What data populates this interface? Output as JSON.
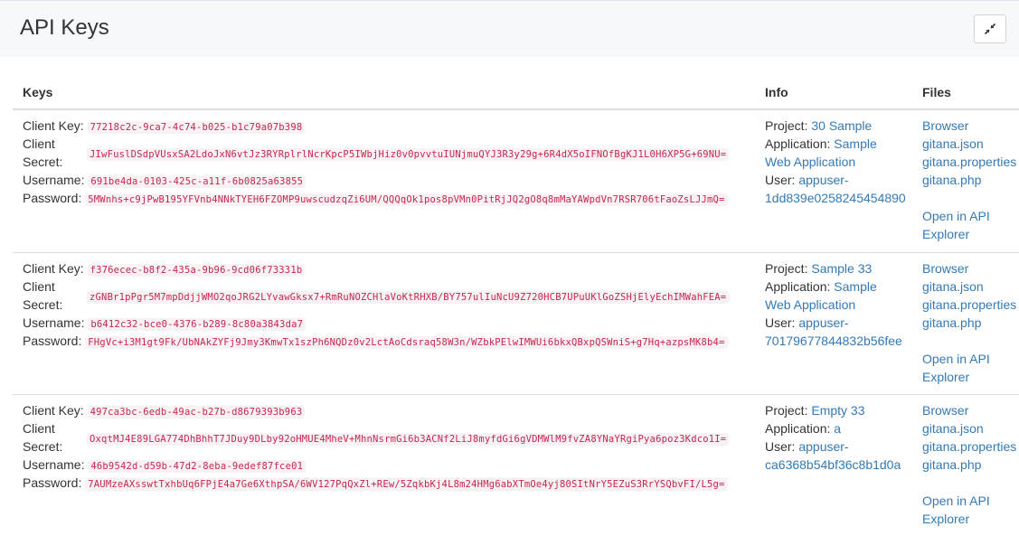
{
  "panel": {
    "title": "API Keys"
  },
  "table": {
    "headers": {
      "keys": "Keys",
      "info": "Info",
      "files": "Files"
    },
    "labels": {
      "client_key": "Client Key:",
      "client": "Client",
      "secret": "Secret:",
      "username": "Username:",
      "password": "Password:",
      "project": "Project:",
      "application": "Application:",
      "user": "User:"
    },
    "rows": [
      {
        "client_key": "77218c2c-9ca7-4c74-b025-b1c79a07b398",
        "client_secret": "JIwFuslDSdpVUsxSA2LdoJxN6vtJz3RYRplrlNcrKpcP5IWbjHiz0v0pvvtuIUNjmuQYJ3R3y29g+6R4dX5oIFNOfBgKJ1L0H6XP5G+69NU=",
        "username": "691be4da-0103-425c-a11f-6b0825a63855",
        "password": "5MWnhs+c9jPwB195YFVnb4NNkTYEH6FZOMP9uwscudzqZi6UM/QQQqOk1pos8pVMn0PitRjJQ2gO8q8mMaYAWpdVn7RSR706tFaoZsLJJmQ=",
        "project": "30 Sample",
        "application_line1": "Sample",
        "application_line2": "Web Application",
        "user_line1": "appuser-",
        "user_line2": "1dd839e0258245454890"
      },
      {
        "client_key": "f376ecec-b8f2-435a-9b96-9cd06f73331b",
        "client_secret": "zGNBr1pPgr5M7mpDdjjWMO2qoJRG2LYvawGksx7+RmRuNOZCHlaVoKtRHXB/BY757ulIuNcU9Z720HCB7UPuUKlGoZSHjElyEchIMWahFEA=",
        "username": "b6412c32-bce0-4376-b289-8c80a3843da7",
        "password": "FHgVc+i3M1gt9Fk/UbNAkZYFj9Jmy3KmwTx1szPh6NQDz0v2LctAoCdsraq58W3n/WZbkPElwIMWUi6bkxQBxpQSWniS+g7Hq+azpsMK8b4=",
        "project": "Sample 33",
        "application_line1": "Sample",
        "application_line2": "Web Application",
        "user_line1": "appuser-",
        "user_line2": "70179677844832b56fee"
      },
      {
        "client_key": "497ca3bc-6edb-49ac-b27b-d8679393b963",
        "client_secret": "OxqtMJ4E89LGA774DhBhhT7JDuy9DLby92oHMUE4MheV+MhnNsrmGi6b3ACNf2LiJ8myfdGi6gVDMWlM9fvZA8YNaYRgiPya6poz3Kdco1I=",
        "username": "46b9542d-d59b-47d2-8eba-9edef87fce01",
        "password": "7AUMzeAXsswtTxhbUq6FPjE4a7Ge6XthpSA/6WV127PqQxZl+REw/5ZqkbKj4L8m24HMg6abXTmOe4yj80SItNrY5EZuS3RrYSQbvFI/L5g=",
        "project": "Empty 33",
        "application_line1": "a",
        "application_line2": "",
        "user_line1": "appuser-",
        "user_line2": "ca6368b54bf36c8b1d0a"
      }
    ],
    "files": {
      "browser": "Browser",
      "json": "gitana.json",
      "properties": "gitana.properties",
      "php": "gitana.php",
      "api_explorer_line1": "Open in API",
      "api_explorer_line2": "Explorer"
    }
  },
  "colors": {
    "code_text": "#c7254e",
    "code_bg": "#f9f2f4",
    "link": "#337ab7",
    "header_bg": "#f7f8fa"
  },
  "icons": {
    "collapse": "compress-icon"
  }
}
